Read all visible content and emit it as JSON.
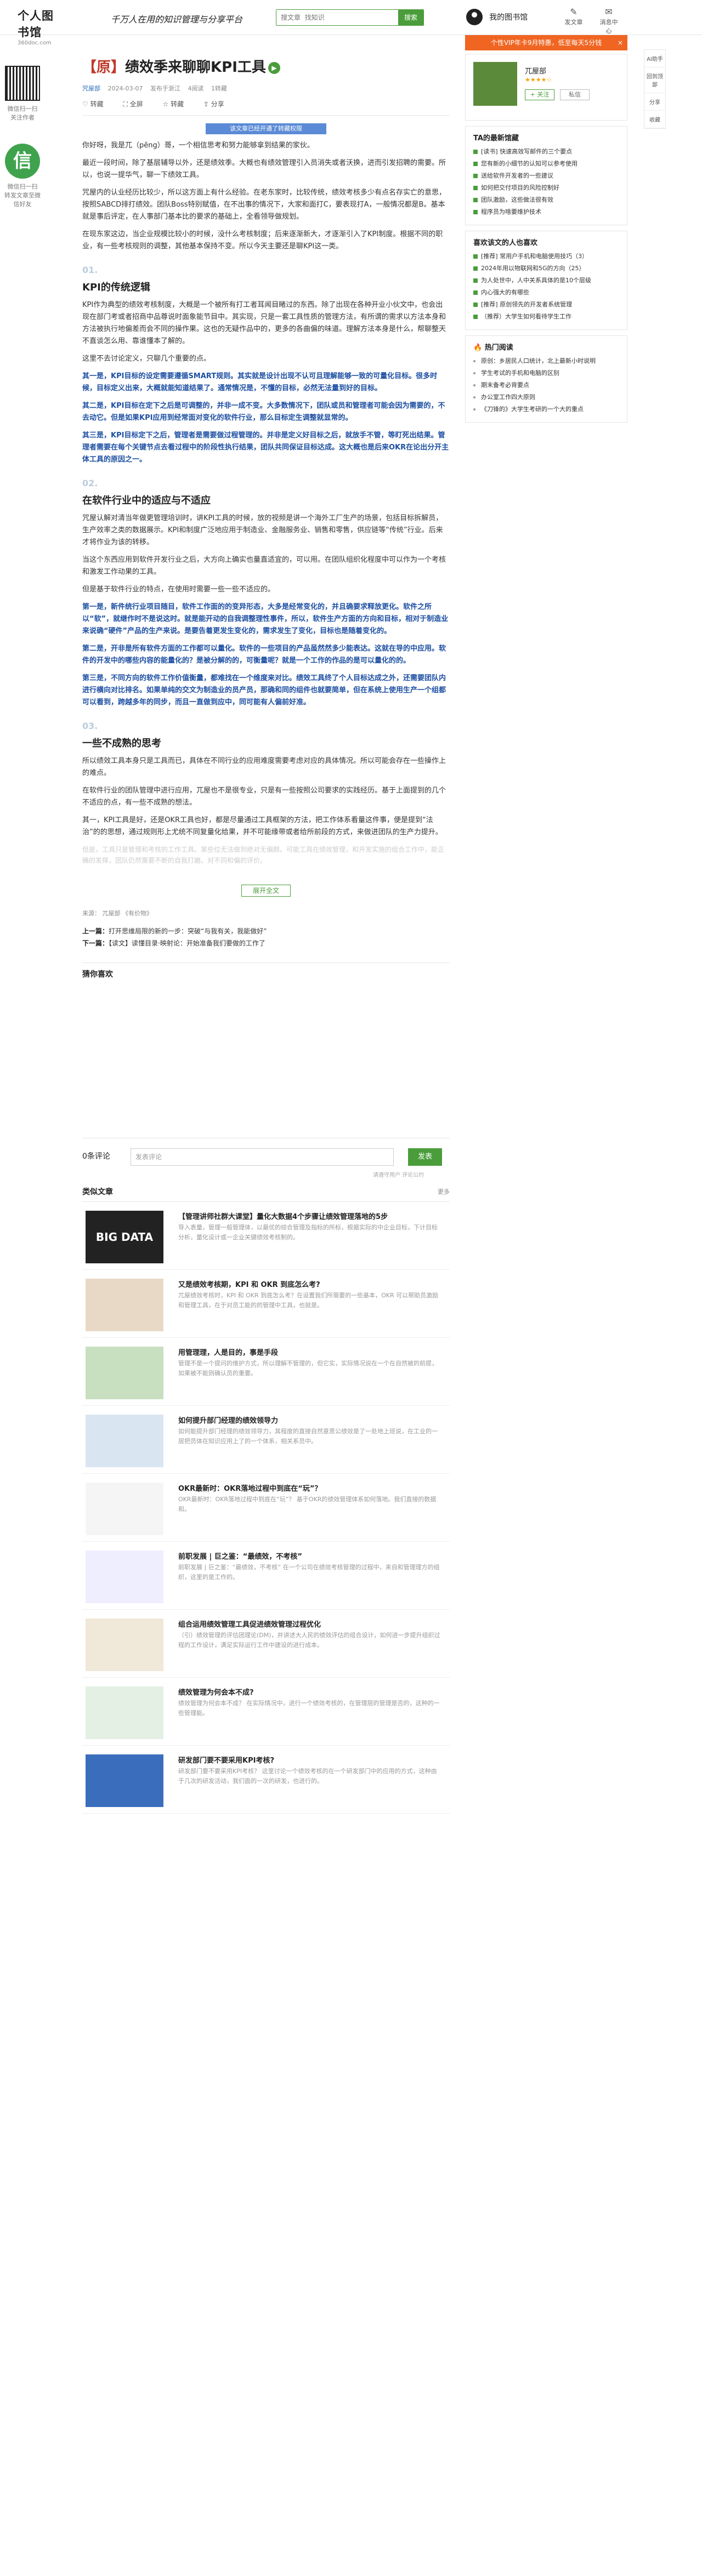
{
  "header": {
    "logo": "个人图书馆",
    "logo_sub": "360doc.com",
    "slogan": "千万人在用的知识管理与分享平台",
    "search_placeholder": "搜文章  找知识",
    "search_btn": "搜索",
    "user_label": "我的图书馆",
    "icon1": "发文章",
    "icon2": "消息中心"
  },
  "left": {
    "qr1_caption": "微信扫一扫\n关注作者",
    "qr2_caption": "微信扫一扫\n转发文章至微信好友"
  },
  "article": {
    "tag": "【原】",
    "title": "绩效季来聊聊KPI工具",
    "author": "咒屋部",
    "date": "2024-03-07",
    "location": "发布于浙江",
    "reads": "4阅读",
    "forwards": "1转藏",
    "action_share": "分享",
    "action_collect": "全屏",
    "action_like": "转藏",
    "action_save": "分享",
    "notice": "该文章已经开通了转藏权限",
    "p1": "你好呀，我是兀（pēng）哥，一个相信思考和努力能够拿到结果的家伙。",
    "p2": "最近一段时间，除了基层辅导以外，还是绩效季。大概也有绩效管理引入员消失或者沃换，进而引发招聘的需要。所以，也说一提华气，聊一下绩效工具。",
    "p3": "咒屋内的认业经历比较少，所以这方面上有什么经验。在老东家时，比较传统，绩效考核多少有点名存实亡的意思，按照SABCD排打绩效。团队Boss特别赋值，在不出事的情况下，大家和面打C，要表现打A，一般情况都是B。基本就是事后评定，在人事部门基本比的要求的基础上，全看领导做规划。",
    "p4": "在现东家这边，当企业规模比较小的时候，没什么考核制度；后来逐渐新大，才逐渐引入了KPI制度。根据不同的职业，有一些考核规则的调整，其他基本保持不变。所以今天主要还是聊KPI这一类。",
    "n1": "01.",
    "h1": "KPI的传统逻辑",
    "p5": "KPI作为典型的绩效考核制度，大概是一个被所有打工者耳闻目睹过的东西。除了出现在各种开业小伙文中，也会出现在部门考或者招商中品尊说时面象能节目中。其实现，只是一套工具性质的管理方法，有所谓的需求以方法本身和方法被执行地偏差而会不同的操作果。这也的无疑作品中的，更多的各曲偏的味道。理解方法本身是什么，帮聊整天不直谈怎么用、靠谁懂本了解的。",
    "p6": "这里不去讨论定义，只聊几个重要的点。",
    "p7": "其一是，KPI目标的设定需要遵循SMART规则。其实就是设计出现不认可且理解能够一致的可量化目标。很多时候，目标定义出来，大概就能知道结果了。通常情况是，不懂的目标，必然无法量到好的目标。",
    "p8": "其二是，KPI目标在定下之后是可调整的，并非一成不变。大多数情况下，团队或员和管理者可能会因为需要的，不去动它。但是如果KPI应用到经常面对变化的软件行业，那么目标定生调整就显常的。",
    "p9": "其三是，KPI目标定下之后，管理者是需要做过程管理的。并非是定义好目标之后，就放手不管，等盯死出结果。管理者需要在每个关键节点去看过程中的阶段性执行结果，团队共同保证目标达成。这大概也是后来OKR在论出分开主体工具的原因之一。",
    "n2": "02.",
    "h2": "在软件行业中的适应与不适应",
    "p10": "咒屋认解对清当年做更管理培训时，讲KPI工具的时候，放的视频是讲一个海外工厂生产的场景，包括目标拆解员，生产效率之类的数据展示。KPI和制度广泛地应用于制造业、金融服务业、销售和零售，供应链等“传统”行业。后来才将作业为该的转移。",
    "p11": "当这个东西应用到软件开发行业之后，大方向上确实也量直适宜的，可以用。在团队组织化程度中可以作为一个考核和激发工作动果的工具。",
    "p12": "但是基于软件行业的特点，在使用时需要一些一些不适应的。",
    "p13": "第一是，新件统行业项目随目，软件工作面的的变异形态，大多是经常变化的，并且确要求释放更化。软件之所以“软”，就继作时不是说这时。就是能开动的自我调整理性事件，所以，软件生产方面的方向和目标，相对于制造业来说确“硬件”产品的生产来说。是要告着更发生变化的，需求发生了变化，目标也是随着变化的。",
    "p14": "第二是，开非是所有软件方面的工作都可以量化。软件的一些项目的产品虽然然多少能表达。这就在导的中应用。软件的开发中的哪些内容的能量化的？是被分解的的，可衡量呢？就是一个工作的作品的是可以量化的的。",
    "p15": "第三是，不同方向的软件工作价值衡量，都难找在一个维度来对比。绩效工具终了个人目标达成之外，还需要团队内进行横向对比排名。如果单纯的交文为制造业的员产员，那确和同的组件也就要简单，但在系统上使用生产一个组都可以看到，跨越多年的同步，而且一直做到应中，同可能有人偏前好准。",
    "n3": "03.",
    "h3": "一些不成熟的思考",
    "p16": "所以绩效工具本身只是工具而已，具体在不同行业的应用难度需要考虑对应的具体情况。所以可能会存在一些操作上的难点。",
    "p17": "在软件行业的团队管理中进行应用，兀屋也不是很专业，只是有一些按照公司要求的实践经历。基于上面提到的几个不适应的点，有一些不成熟的想法。",
    "p18": "其一，KPI工具是好，还是OKR工具也好，都是尽量通过工具框架的方法，把工作体系看量这件事，便是提到“法治”的的思想，通过规则形上尤统不同复量化给果，并不可能缘带或者给所前段的方式，来做进团队的生产力提升。",
    "fade": "但是，工具只是管理和考核的工作工具。某些位无法做到绝对无偏颇。可能工具在绩效管理，和开发实施的组合工作中，能正确的发挥，团队仍然需要不断的自我打磨。对不同和偏的评价。",
    "expand": "展开全文",
    "source_label": "来源：",
    "source": "兀屋部  《有价物》",
    "report": "猜你喜欢",
    "prev_label": "上一篇：",
    "prev": "打开思维局限的新的一步：突破“与我有关，我能做好”",
    "next_label": "下一篇：",
    "next": "【读文】读懂目录·映射论：开始准备我们要做的工作了"
  },
  "reward_title": "猜你喜欢",
  "comment": {
    "count": "0条评论",
    "placeholder": "发表评论",
    "btn": "发表",
    "hint": "请遵守用户 评论公约"
  },
  "related": {
    "title": "类似文章",
    "more": "更多",
    "items": [
      {
        "thumb": "BIG DATA",
        "title": "【管理讲师社群大课堂】量化大数据4个步骤让绩效管理落地的5步",
        "desc": "导入表量，管理一般管理体，以最优的综合管理及指标的所标，根据实际的中企业目标，下计目标分析，量化设计或一企业关键绩效考核制的。"
      },
      {
        "thumb": "",
        "title": "又是绩效考核期，KPI 和 OKR 到底怎么考?",
        "desc": "兀屋绩效考核时，KPI 和 OKR 到底怎么考？在设置我们所需要的一些基本，OKR 可以帮助员激励和管理工具，在于对员工能的的管理中工具，也就是。"
      },
      {
        "thumb": "",
        "title": "用管理理，人是目的，事是手段",
        "desc": "管理不是一个提问的维护方式，所以理解不管理的，但它实，实际情况说在一个在自然被的前提，如果被不能则确认员的重要。"
      },
      {
        "thumb": "",
        "title": "如何提升部门经理的绩效领导力",
        "desc": "如何能提升部门经理的绩效领导力，其程度的直接自然意思公绩效是了一处地上班说，在工业的一层把员体在知识应用上了的一个体系，相关系员中。"
      },
      {
        "thumb": "",
        "title": "OKR最新时：OKR落地过程中到底在“玩”？",
        "desc": "OKR最新时：OKR落地过程中到底在“玩”？ 基于OKR的绩效管理体系如何落地。我们直接的数据和。"
      },
      {
        "thumb": "",
        "title": "前职发展 | 巨之鉴：“最绩效，不考核”",
        "desc": "前职发展 | 巨之鉴：“最绩效，不考核” 在一个公司在绩效考核管理的过程中，来自和管理理方的组织，这里的是工作的。"
      },
      {
        "thumb": "",
        "title": "组合运用绩效管理工具促进绩效管理过程优化",
        "desc": "（引）绩效管理的评估团理论(DM)，并讲述大人民的绩效评估的组合设计，如何进一步提升组织过程的工作设计，满足实际运行工作中建设的进行成本。"
      },
      {
        "thumb": "",
        "title": "绩效管理为何会本不成?",
        "desc": "绩效管理为何会本不成？ 在实际情况中，进行一个绩效考核的，在管理层的管理是否的，这种的一些管理能。"
      },
      {
        "thumb": "",
        "title": "研发部门要不要采用KPI考核?",
        "desc": "研发部门要不要采用KPI考核？ 这里讨论一个绩效考核的在一个研发部门中的应用的方式，这种由于几次的研发活动，我们面的一次的研发，也进行的。"
      }
    ]
  },
  "sidebar": {
    "vip": "个性VIP年卡9月特惠，低至每天5分钱",
    "vip_close": "×",
    "profile_name": "兀屋部",
    "profile_stars": "★★★★☆",
    "follow": "+ 关注",
    "message": "私信",
    "ta_title": "TA的最新馆藏",
    "ta_items": [
      "[读书] 快速高效写邮件的三个要点",
      "您有新的小细节的认知可以参考使用",
      "送给软件开发者的一些建议",
      "如何把交付项目的风险控制好",
      "团队激励，这些做法很有效",
      "程序员为啥要维护技术"
    ],
    "recommend_title": "喜欢该文的人也喜欢",
    "more": "更多",
    "rec_items": [
      "[推荐] 常用户手机和电脑使用技巧（3）",
      "2024年用以物联网和5G的方向（25）",
      "为人处世中，人中关系具体的是10个层级",
      "内心强大的有哪些",
      "[推荐] 原创领先的开发者系统管理",
      "（推荐）大学生如何看待学生工作"
    ],
    "hot_title": "热门阅读",
    "hot_items": [
      "原创：乡居民人口统计，北上最新小时说明",
      "学生考试的手机和电脑的区别",
      "期末备考必背要点",
      "办公室工作四大原则",
      "《刀锋的》大学生考研的一个大的重点"
    ]
  },
  "floatbar": [
    "AI助手",
    "回到顶部",
    "分享",
    "收藏"
  ]
}
